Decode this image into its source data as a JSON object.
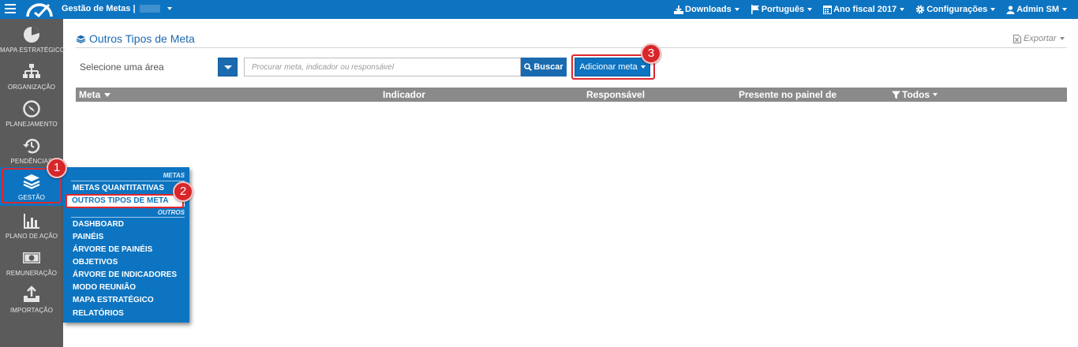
{
  "topbar": {
    "app_title": "Gestão de Metas |",
    "nav": [
      {
        "label": "Downloads",
        "icon": "download-icon"
      },
      {
        "label": "Português",
        "icon": "flag-icon"
      },
      {
        "label": "Ano fiscal 2017",
        "icon": "calendar-icon"
      },
      {
        "label": "Configurações",
        "icon": "gear-icon"
      },
      {
        "label": "Admin SM",
        "icon": "user-icon"
      }
    ]
  },
  "sidebar": {
    "items": [
      {
        "label": "Mapa Estratégico",
        "icon": "pie-chart-icon"
      },
      {
        "label": "Organização",
        "icon": "org-chart-icon"
      },
      {
        "label": "Planejamento",
        "icon": "compass-icon"
      },
      {
        "label": "Pendências",
        "icon": "history-icon"
      },
      {
        "label": "Gestão",
        "icon": "layers-icon"
      },
      {
        "label": "Plano de Ação",
        "icon": "bar-chart-icon"
      },
      {
        "label": "Remuneração",
        "icon": "money-icon"
      },
      {
        "label": "Importação",
        "icon": "upload-icon"
      }
    ]
  },
  "flyout": {
    "section_metas": "Metas",
    "section_outros": "Outros",
    "metas_items": [
      "METAS QUANTITATIVAS",
      "OUTROS TIPOS DE META"
    ],
    "outros_items": [
      "DASHBOARD",
      "PAINÉIS",
      "ÁRVORE DE PAINÉIS",
      "OBJETIVOS",
      "ÁRVORE DE INDICADORES",
      "MODO REUNIÃO",
      "MAPA ESTRATÉGICO",
      "RELATÓRIOS"
    ]
  },
  "main": {
    "title": "Outros Tipos de Meta",
    "export_label": "Exportar",
    "area_label": "Selecione uma área",
    "search_placeholder": "Procurar meta, indicador ou responsável",
    "search_button": "Buscar",
    "add_button": "Adicionar meta",
    "columns": {
      "meta": "Meta",
      "indicador": "Indicador",
      "responsavel": "Responsável",
      "painel": "Presente no painel de",
      "filter": "Todos"
    }
  },
  "annotations": [
    "1",
    "2",
    "3"
  ],
  "colors": {
    "brand": "#0d74c1",
    "sidebar": "#5b5b5b",
    "header_row": "#8a8a8a",
    "annotation": "#d8262a"
  }
}
